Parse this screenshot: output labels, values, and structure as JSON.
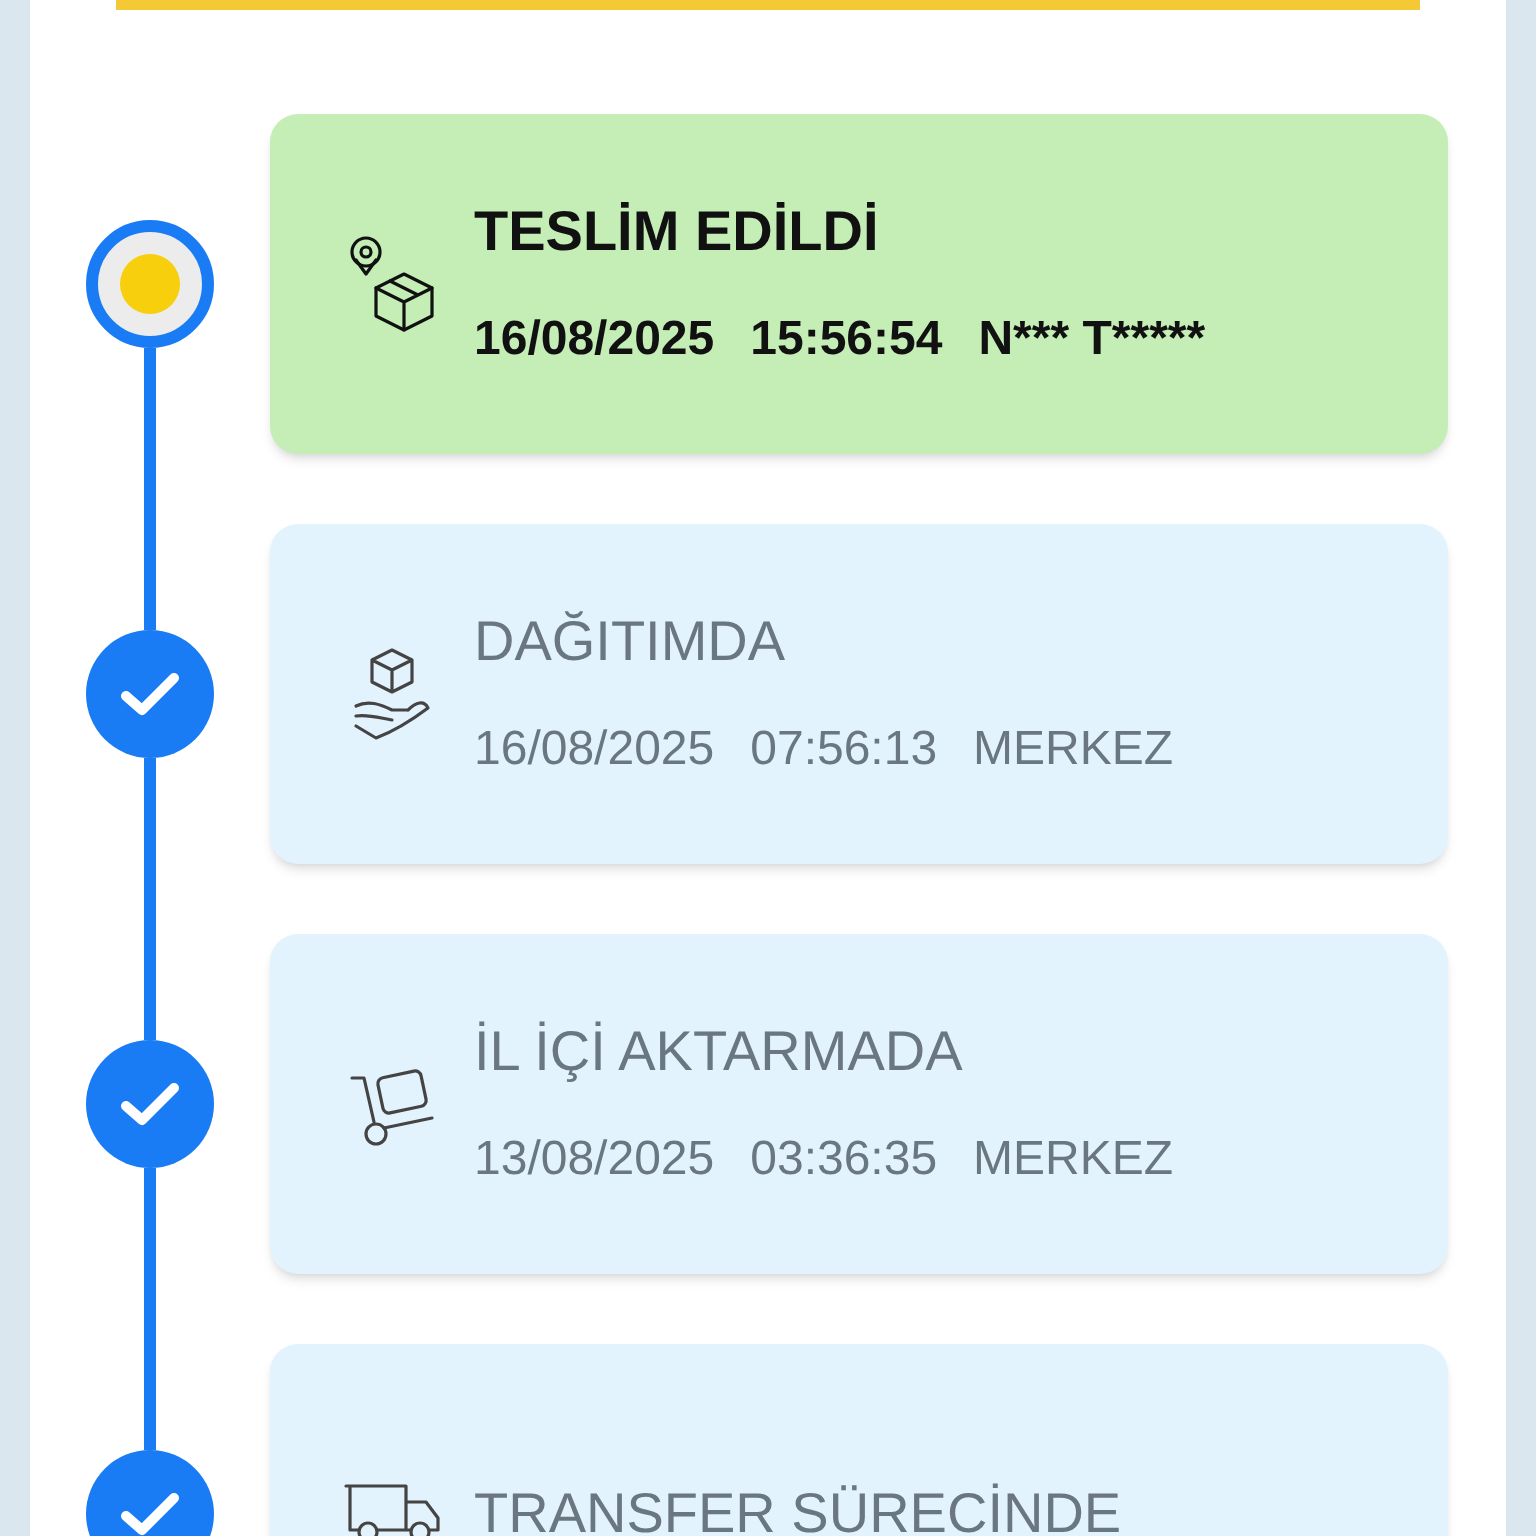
{
  "events": [
    {
      "status": "TESLİM EDİLDİ",
      "current": true,
      "details": [
        "16/08/2025",
        "15:56:54",
        "N*** T*****"
      ]
    },
    {
      "status": "DAĞITIMDA",
      "current": false,
      "details": [
        "16/08/2025",
        "07:56:13",
        "MERKEZ"
      ]
    },
    {
      "status": "İL İÇİ AKTARMADA",
      "current": false,
      "details": [
        "13/08/2025",
        "03:36:35",
        "MERKEZ"
      ]
    },
    {
      "status": "TRANSFER SÜRECİNDE",
      "current": false
    }
  ]
}
